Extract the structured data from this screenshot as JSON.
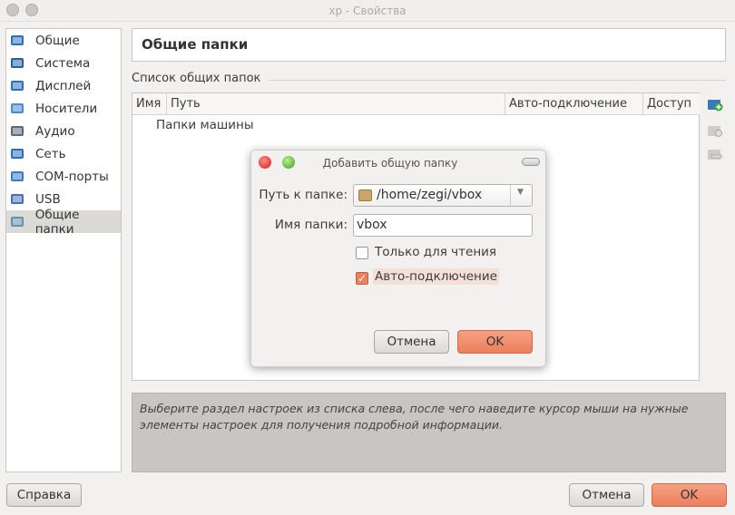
{
  "window": {
    "title": "xp - Свойства"
  },
  "sidebar": {
    "items": [
      {
        "label": "Общие",
        "icon": "general-icon"
      },
      {
        "label": "Система",
        "icon": "system-icon"
      },
      {
        "label": "Дисплей",
        "icon": "display-icon"
      },
      {
        "label": "Носители",
        "icon": "storage-icon"
      },
      {
        "label": "Аудио",
        "icon": "audio-icon"
      },
      {
        "label": "Сеть",
        "icon": "network-icon"
      },
      {
        "label": "COM-порты",
        "icon": "serial-ports-icon"
      },
      {
        "label": "USB",
        "icon": "usb-icon"
      },
      {
        "label": "Общие папки",
        "icon": "shared-folders-icon",
        "selected": true
      }
    ]
  },
  "page": {
    "title": "Общие папки",
    "group_label": "Список общих папок",
    "table": {
      "columns": [
        "Имя",
        "Путь",
        "Авто-подключение",
        "Доступ"
      ],
      "rows": [
        {
          "name": "Папки машины"
        }
      ]
    }
  },
  "info": {
    "text": "Выберите раздел настроек из списка слева, после чего наведите курсор мыши на нужные элементы настроек для получения подробной информации."
  },
  "footer": {
    "help": "Справка",
    "cancel": "Отмена",
    "ok": "OK"
  },
  "dialog": {
    "title": "Добавить общую папку",
    "path_label": "Путь к папке:",
    "path_value": "/home/zegi/vbox",
    "name_label": "Имя папки:",
    "name_value": "vbox",
    "readonly_label": "Только для чтения",
    "readonly_checked": false,
    "automount_label": "Авто-подключение",
    "automount_checked": true,
    "cancel": "Отмена",
    "ok": "OK"
  }
}
